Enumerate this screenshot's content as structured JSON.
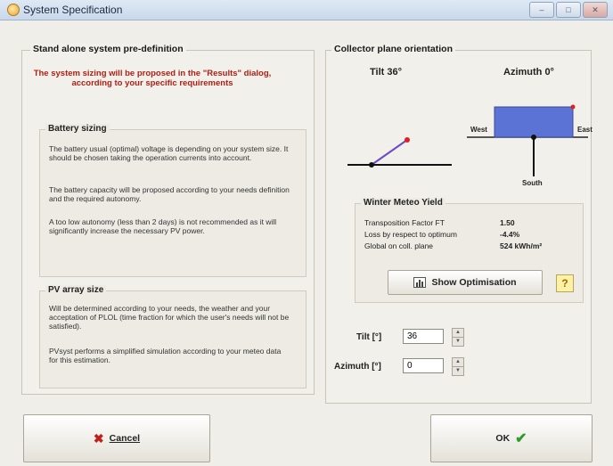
{
  "window": {
    "title": "System Specification",
    "controls": [
      "–",
      "□",
      "✕"
    ]
  },
  "left_panel": {
    "title": "Stand alone system pre-definition",
    "note": "The system sizing will be proposed in the \"Results\" dialog, according to your specific requirements",
    "battery": {
      "title": "Battery sizing",
      "p1": "The battery usual (optimal) voltage is depending on your system size. It should be chosen taking the operation currents into account.",
      "p2": "The battery capacity will be proposed according to your needs definition and the required autonomy.",
      "p3": "A too low autonomy (less than 2 days) is not recommended as it will significantly increase the necessary PV power."
    },
    "pv": {
      "title": "PV array size",
      "p1": "Will be determined according to your needs, the weather and your acceptation of PLOL (time fraction for which the user's needs will not be satisfied).",
      "p2": "PVsyst performs a simplified simulation according to your meteo data for this estimation."
    }
  },
  "right_panel": {
    "title": "Collector plane orientation",
    "tilt_caption": "Tilt 36°",
    "azimuth_caption": "Azimuth 0°",
    "compass": {
      "west": "West",
      "east": "East",
      "south": "South"
    },
    "winter": {
      "title": "Winter Meteo Yield",
      "rows": [
        {
          "label": "Transposition Factor FT",
          "value": "1.50"
        },
        {
          "label": "Loss by respect to optimum",
          "value": "-4.4%"
        },
        {
          "label": "Global  on coll. plane",
          "value": "524 kWh/m²"
        }
      ],
      "show_button": "Show Optimisation",
      "help_label": "?"
    },
    "tilt_field": {
      "label": "Tilt [°]",
      "value": "36"
    },
    "azimuth_field": {
      "label": "Azimuth [°]",
      "value": "0"
    }
  },
  "buttons": {
    "cancel": "Cancel",
    "ok": "OK"
  },
  "colors": {
    "note_red": "#b01f14",
    "panel_blue": "#5a73d4",
    "accent_purple": "#6b4bc8",
    "marker_red": "#e02020"
  }
}
